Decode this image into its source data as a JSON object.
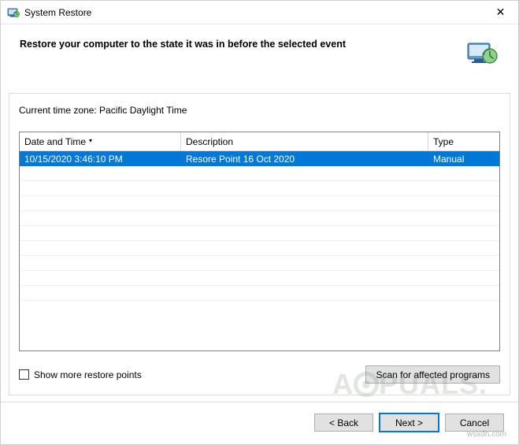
{
  "titlebar": {
    "title": "System Restore",
    "close_symbol": "✕"
  },
  "header": {
    "text": "Restore your computer to the state it was in before the selected event"
  },
  "content": {
    "timezone_label": "Current time zone: Pacific Daylight Time"
  },
  "table": {
    "columns": {
      "date": "Date and Time",
      "description": "Description",
      "type": "Type"
    },
    "rows": [
      {
        "date": "10/15/2020 3:46:10 PM",
        "description": "Resore Point 16 Oct 2020",
        "type": "Manual",
        "selected": true
      }
    ]
  },
  "checkbox": {
    "label": "Show more restore points",
    "checked": false
  },
  "buttons": {
    "scan": "Scan for affected programs",
    "back": "< Back",
    "next": "Next >",
    "cancel": "Cancel"
  },
  "watermark": {
    "text_left": "A",
    "text_right": "PUALS."
  },
  "source_text": "wsxdn.com"
}
